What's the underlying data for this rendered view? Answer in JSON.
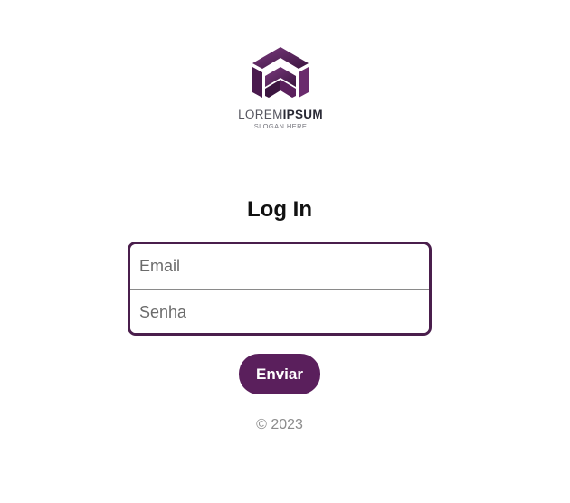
{
  "logo": {
    "word_light": "LOREM",
    "word_bold": "IPSUM",
    "slogan": "SLOGAN HERE",
    "colors": {
      "primary": "#5a1f5c",
      "dark": "#3b1540",
      "shadow": "#7a3a7c"
    }
  },
  "login": {
    "title": "Log In",
    "email_placeholder": "Email",
    "password_placeholder": "Senha",
    "submit_label": "Enviar"
  },
  "footer": {
    "copyright": "© 2023"
  },
  "theme": {
    "accent": "#5a1f5c",
    "border": "#4a1e4c",
    "muted_text": "#8c8c8c"
  }
}
